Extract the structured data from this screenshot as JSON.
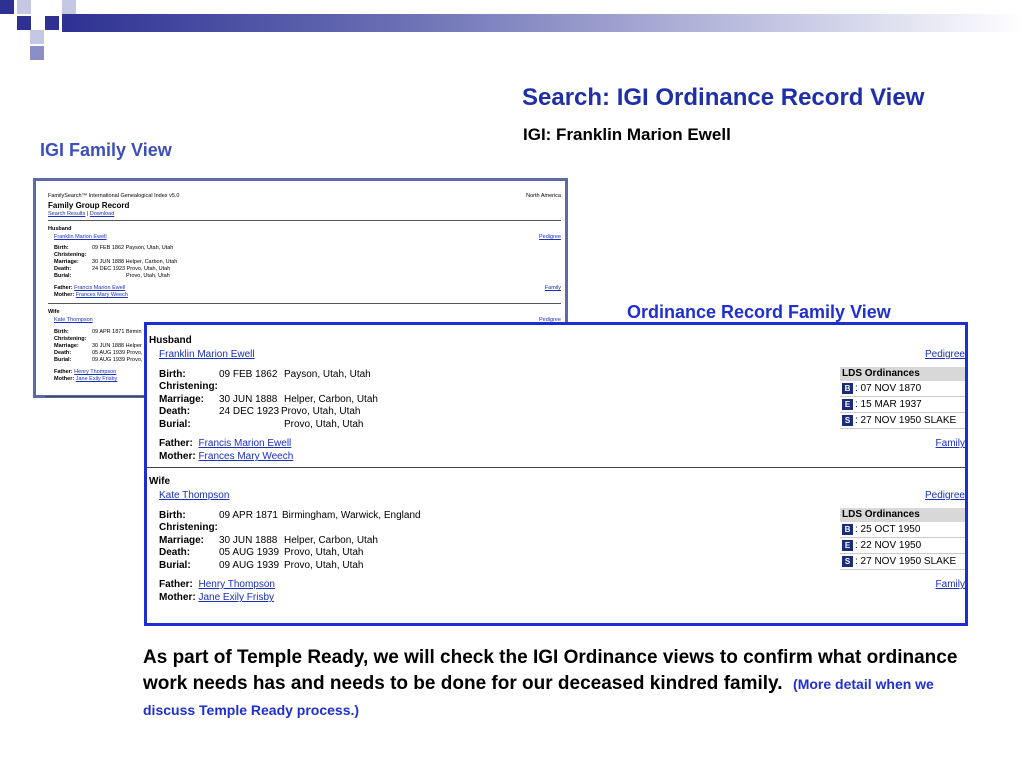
{
  "slide": {
    "title": "Search:  IGI Ordinance Record View",
    "subtitle": "IGI:  Franklin Marion Ewell",
    "label_family_view": "IGI Family View",
    "label_ordinance_view": "Ordinance Record Family View",
    "paragraph": "As part of Temple Ready, we will check the IGI Ordinance views to confirm what ordinance work needs has and needs to be done for our deceased kindred family.",
    "paragraph_note": "(More detail when we discuss Temple Ready process.)"
  },
  "colors": {
    "accent": "#1f2fa8",
    "label": "#3d4fb8",
    "link": "#1a2fbf",
    "frame": "#1c2ed4"
  },
  "mini": {
    "app": "FamilySearch™ International Genealogical Index v5.0",
    "region": "North America",
    "heading": "Family Group Record",
    "links": {
      "search_results": "Search Results",
      "sep": "|",
      "download": "Download"
    },
    "husband": {
      "section": "Husband",
      "name": "Franklin Marion Ewell",
      "pedigree": "Pedigree",
      "birth_label": "Birth:",
      "birth": "09 FEB 1862 Payson, Utah, Utah",
      "christening_label": "Christening:",
      "marriage_label": "Marriage:",
      "marriage": "30 JUN 1888 Helper, Carbon, Utah",
      "death_label": "Death:",
      "death": "24 DEC 1923 Provo, Utah, Utah",
      "burial_label": "Burial:",
      "burial": "Provo, Utah, Utah",
      "father_label": "Father:",
      "father": "Francis Marion Ewell",
      "mother_label": "Mother:",
      "mother": "Frances Mary Weech",
      "family": "Family"
    },
    "wife": {
      "section": "Wife",
      "name": "Kate Thompson",
      "pedigree": "Pedigree",
      "birth_label": "Birth:",
      "birth": "09 APR 1871  Birmin",
      "christening_label": "Christening:",
      "marriage_label": "Marriage:",
      "marriage": "30 JUN 1888  Helper",
      "death_label": "Death:",
      "death": "05 AUG 1939 Provo,",
      "burial_label": "Burial:",
      "burial": "09 AUG 1939 Provo,",
      "father_label": "Father:",
      "father": "Henry Thompson",
      "mother_label": "Mother:",
      "mother": "Jane Exily Frisby"
    }
  },
  "ordinance_view": {
    "husband": {
      "section": "Husband",
      "name": "Franklin Marion Ewell",
      "pedigree": "Pedigree",
      "birth_label": "Birth:",
      "birth_date": "09 FEB 1862",
      "birth_place": "Payson, Utah, Utah",
      "christening_label": "Christening:",
      "marriage_label": "Marriage:",
      "marriage_date": "30 JUN 1888",
      "marriage_place": "Helper, Carbon, Utah",
      "death_label": "Death:",
      "death_date": "24 DEC 1923",
      "death_place": "Provo, Utah, Utah",
      "burial_label": "Burial:",
      "burial_place": "Provo, Utah, Utah",
      "father_label": "Father:",
      "father": "Francis Marion Ewell",
      "mother_label": "Mother:",
      "mother": "Frances Mary Weech",
      "family": "Family",
      "ordinances_title": "LDS Ordinances",
      "ordinances": [
        {
          "code": "B",
          "text": ": 07 NOV 1870"
        },
        {
          "code": "E",
          "text": ": 15 MAR 1937"
        },
        {
          "code": "S",
          "text": ": 27 NOV 1950   SLAKE"
        }
      ]
    },
    "wife": {
      "section": "Wife",
      "name": "Kate Thompson",
      "pedigree": "Pedigree",
      "birth_label": "Birth:",
      "birth_date": "09 APR 1871",
      "birth_place": "Birmingham, Warwick, England",
      "christening_label": "Christening:",
      "marriage_label": "Marriage:",
      "marriage_date": "30 JUN 1888",
      "marriage_place": "Helper, Carbon, Utah",
      "death_label": "Death:",
      "death_date": "05 AUG 1939",
      "death_place": "Provo, Utah, Utah",
      "burial_label": "Burial:",
      "burial_date": "09 AUG 1939",
      "burial_place": "Provo, Utah, Utah",
      "father_label": "Father:",
      "father": "Henry Thompson",
      "mother_label": "Mother:",
      "mother": "Jane Exily Frisby",
      "family": "Family",
      "ordinances_title": "LDS Ordinances",
      "ordinances": [
        {
          "code": "B",
          "text": ": 25 OCT 1950"
        },
        {
          "code": "E",
          "text": ": 22 NOV 1950"
        },
        {
          "code": "S",
          "text": ": 27 NOV 1950   SLAKE"
        }
      ]
    }
  }
}
